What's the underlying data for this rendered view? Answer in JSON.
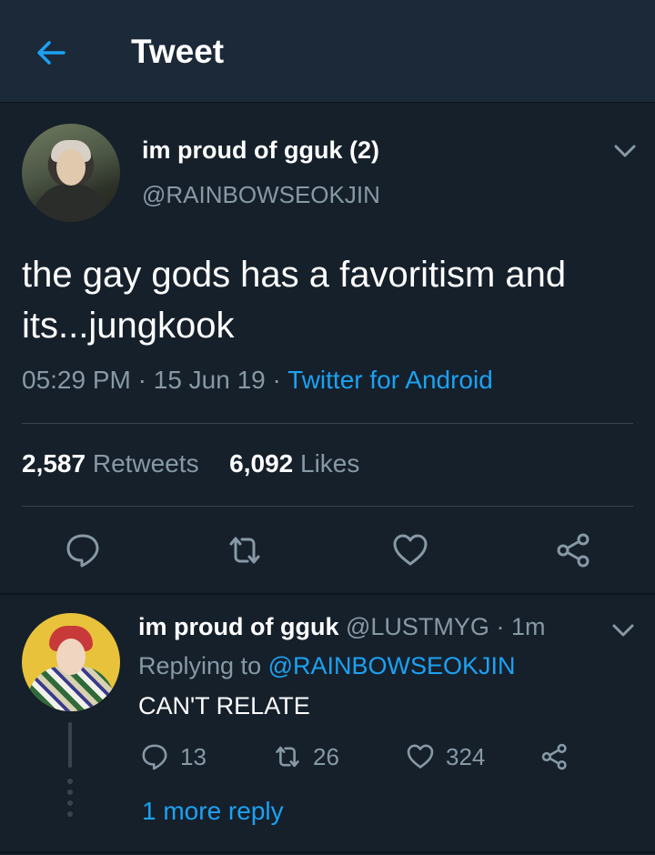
{
  "header": {
    "title": "Tweet",
    "back_icon": "arrow-left-icon"
  },
  "tweet": {
    "display_name": "im proud of gguk (2)",
    "handle": "@RAINBOWSEOKJIN",
    "text": "the gay gods has a favoritism and its...jungkook",
    "time": "05:29 PM",
    "date": "15 Jun 19",
    "source": "Twitter for Android",
    "retweets_count": "2,587",
    "retweets_label": "Retweets",
    "likes_count": "6,092",
    "likes_label": "Likes"
  },
  "reply": {
    "display_name": "im proud of gguk",
    "handle": "@LUSTMYG",
    "age": "1m",
    "replying_to_label": "Replying to",
    "replying_to_handle": "@RAINBOWSEOKJIN",
    "text": "CAN'T RELATE",
    "reply_count": "13",
    "retweet_count": "26",
    "like_count": "324",
    "more_replies": "1 more reply"
  },
  "colors": {
    "background": "#15202b",
    "header": "#1c2938",
    "accent": "#1da1f2",
    "secondary_text": "#8899a6",
    "divider": "#38444d"
  }
}
